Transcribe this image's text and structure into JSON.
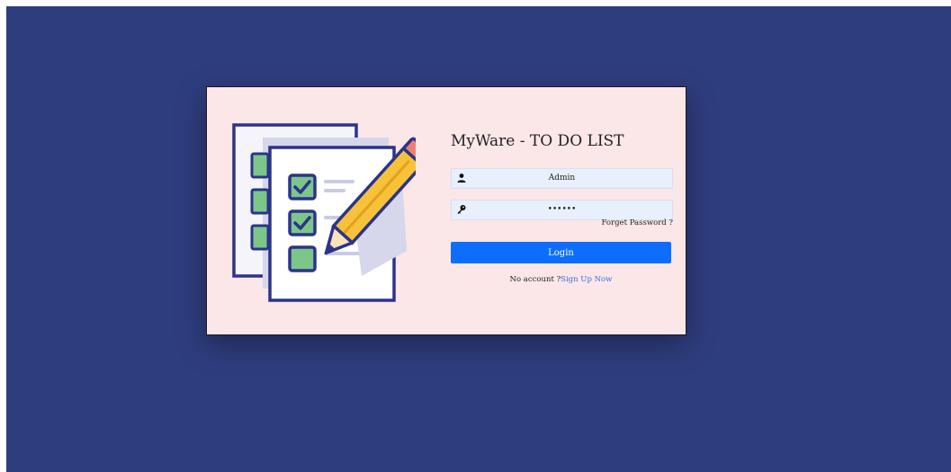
{
  "app": {
    "title": "MyWare - TO DO LIST"
  },
  "form": {
    "username_value": "Admin",
    "password_mask": "••••••",
    "forgot_label": "Forget Password ?",
    "login_label": "Login",
    "no_account_text": "No account ?",
    "signup_label": "Sign Up Now"
  },
  "icons": {
    "username": "user-icon",
    "password": "key-icon",
    "illustration": "checklist-pencil-icon"
  },
  "colors": {
    "background": "#2e3d7e",
    "card": "#fbe6e8",
    "primary": "#0d6efd",
    "link": "#3b6fe0",
    "field_bg": "#e8f0fe"
  }
}
